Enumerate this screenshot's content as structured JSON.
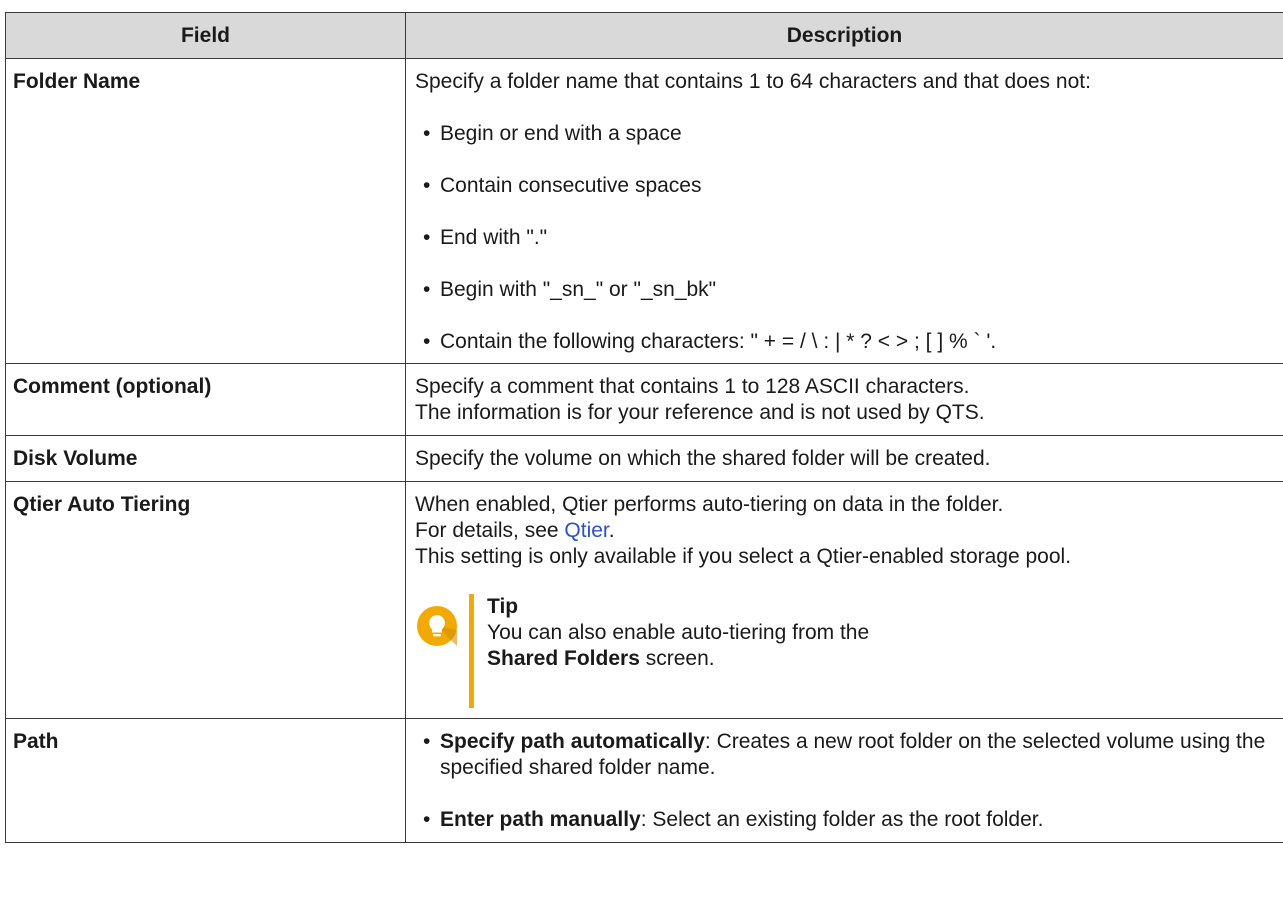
{
  "header": {
    "field": "Field",
    "description": "Description"
  },
  "rows": {
    "folder_name": {
      "field": "Folder Name",
      "intro": "Specify a folder name that contains 1 to 64 characters and that does not:",
      "bullets": [
        "Begin or end with a space",
        "Contain consecutive spaces",
        "End with \".\"",
        "Begin with \"_sn_\" or \"_sn_bk\"",
        "Contain the following characters: \" + = / \\ : | * ? < > ; [ ] % ` '."
      ]
    },
    "comment": {
      "field": "Comment (optional)",
      "line1": "Specify a comment that contains 1 to 128 ASCII characters.",
      "line2": "The information is for your reference and is not used by QTS."
    },
    "disk_volume": {
      "field": "Disk Volume",
      "line1": "Specify the volume on which the shared folder will be created."
    },
    "qtier": {
      "field": "Qtier Auto Tiering",
      "line1": "When enabled, Qtier performs auto-tiering on data in the folder.",
      "line2_prefix": "For details, see ",
      "line2_link": "Qtier",
      "line2_suffix": ".",
      "line3": "This setting is only available if you select a Qtier-enabled storage pool.",
      "tip": {
        "icon": "lightbulb-icon",
        "title": "Tip",
        "text_prefix": "You can also enable auto-tiering from the ",
        "bold": "Shared Folders",
        "text_suffix": " screen."
      }
    },
    "path": {
      "field": "Path",
      "items": [
        {
          "bold": "Specify path automatically",
          "text": ": Creates a new root folder on the selected volume using the specified shared folder name."
        },
        {
          "bold": "Enter path manually",
          "text": ": Select an existing folder as the root folder."
        }
      ]
    }
  },
  "colors": {
    "header_bg": "#d9d9d9",
    "link": "#2b4fd8",
    "tip_accent": "#f2a900"
  }
}
